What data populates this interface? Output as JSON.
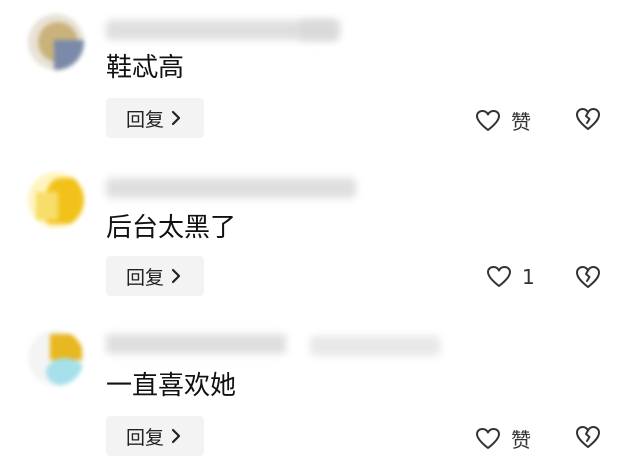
{
  "comments": [
    {
      "text": "鞋忒高",
      "reply_label": "回复",
      "like_label": "赞",
      "avatar_colors": [
        "#c9b27c",
        "#7a8aa8",
        "#e8e2d6"
      ]
    },
    {
      "text": "后台太黑了",
      "reply_label": "回复",
      "like_label": "1",
      "avatar_colors": [
        "#f2c21b",
        "#f7dd6a",
        "#fff4c0"
      ]
    },
    {
      "text": "一直喜欢她",
      "reply_label": "回复",
      "like_label": "赞",
      "avatar_colors": [
        "#e8b820",
        "#a6e0ea",
        "#f4f4f4"
      ]
    }
  ],
  "icons": {
    "like": "heart-outline-icon",
    "dislike": "broken-heart-icon",
    "chevron": "chevron-right-icon"
  },
  "colors": {
    "text": "#111111",
    "button_bg": "#f3f3f3",
    "icon": "#333333"
  }
}
